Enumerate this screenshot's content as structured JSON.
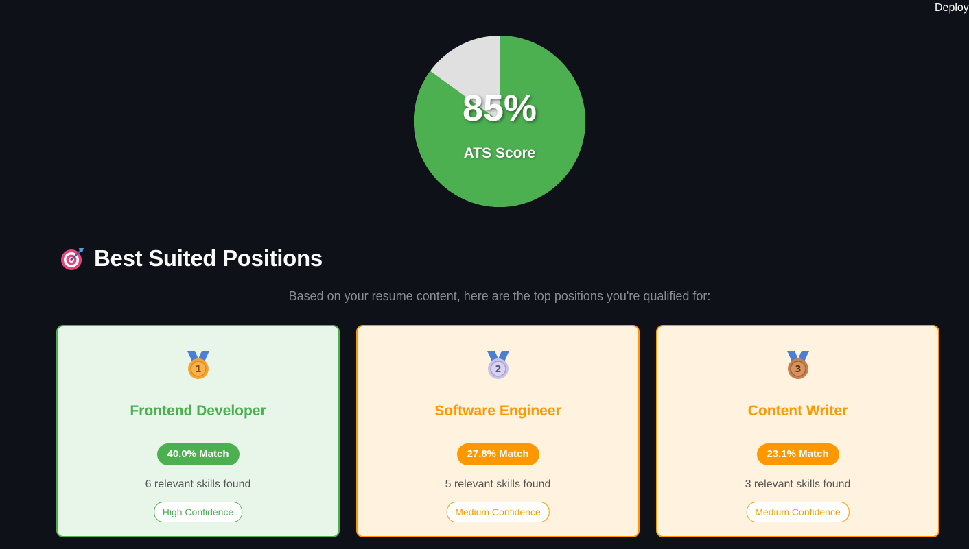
{
  "header": {
    "deploy_label": "Deploy"
  },
  "ats": {
    "score_text": "85%",
    "score_value": 85,
    "label": "ATS Score",
    "fill_color": "#4caf50",
    "remainder_color": "#e0e0e0"
  },
  "section": {
    "icon": "direct-hit-target-icon",
    "title": "Best Suited Positions",
    "subtitle": "Based on your resume content, here are the top positions you're qualified for:"
  },
  "positions": [
    {
      "rank": "1",
      "medal": "gold-medal-icon",
      "title": "Frontend Developer",
      "match": "40.0% Match",
      "skills": "6 relevant skills found",
      "confidence": "High Confidence",
      "accent_color": "#4caf50"
    },
    {
      "rank": "2",
      "medal": "silver-medal-icon",
      "title": "Software Engineer",
      "match": "27.8% Match",
      "skills": "5 relevant skills found",
      "confidence": "Medium Confidence",
      "accent_color": "#ff9800"
    },
    {
      "rank": "3",
      "medal": "bronze-medal-icon",
      "title": "Content Writer",
      "match": "23.1% Match",
      "skills": "3 relevant skills found",
      "confidence": "Medium Confidence",
      "accent_color": "#ff9800"
    }
  ]
}
